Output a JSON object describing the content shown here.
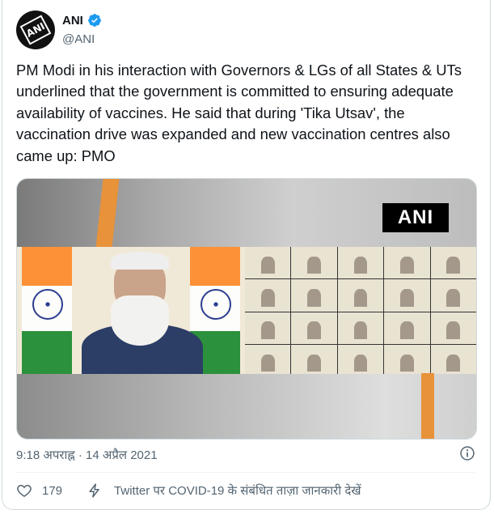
{
  "author": {
    "display_name": "ANI",
    "handle": "@ANI",
    "avatar_text": "ANI",
    "verified": true
  },
  "tweet": {
    "text": "PM Modi in his interaction with Governors & LGs of all States & UTs underlined that the government is committed to ensuring adequate availability of vaccines. He said that during 'Tika Utsav', the vaccination drive was expanded and new vaccination centres also came up: PMO",
    "timestamp": "9:18 अपराह्न · 14 अप्रैल 2021"
  },
  "media": {
    "watermark": "ANI"
  },
  "actions": {
    "like_count": "179",
    "covid_link": "Twitter पर COVID-19 के संबंधित ताज़ा जानकारी देखें"
  },
  "colors": {
    "verified_blue": "#1d9bf0",
    "secondary_text": "#536471",
    "accent_orange": "#e8923a"
  },
  "icons": [
    "verified-badge-icon",
    "info-icon",
    "heart-icon",
    "lightning-icon"
  ]
}
